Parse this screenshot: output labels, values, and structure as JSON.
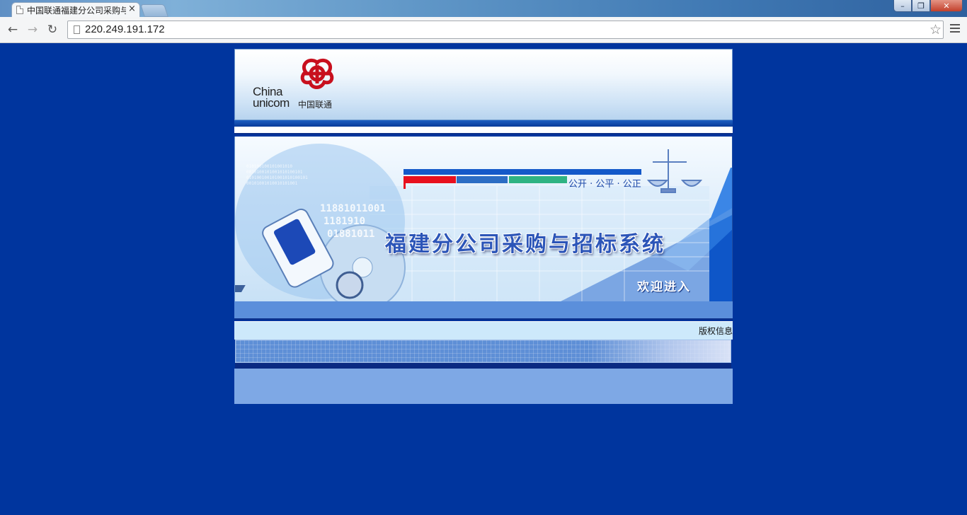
{
  "browser": {
    "tab_title": "中国联通福建分公司采购与招标系统",
    "tab_close": "×",
    "url": "220.249.191.172",
    "window_buttons": {
      "minimize": "–",
      "restore": "❐",
      "close": "✕"
    },
    "nav": {
      "back": "←",
      "forward": "→",
      "reload": "↻",
      "star": "☆"
    }
  },
  "header": {
    "logo_text_line1": "China",
    "logo_text_line2": "unicom",
    "logo_text_cn": "中国联通",
    "logo_color": "#c8101e"
  },
  "banner": {
    "slogan": "公开 · 公平 · 公正",
    "title": "福建分公司采购与招标系统",
    "welcome": "欢迎进入",
    "stripe_colors": [
      "#e8101e",
      "#2c6dc4",
      "#2fb383"
    ]
  },
  "footer": {
    "copyright": "版权信息"
  },
  "colors": {
    "page_background": "#00359e",
    "band_blue": "#5b8fdb",
    "copyright_bg": "#cde9fb"
  }
}
